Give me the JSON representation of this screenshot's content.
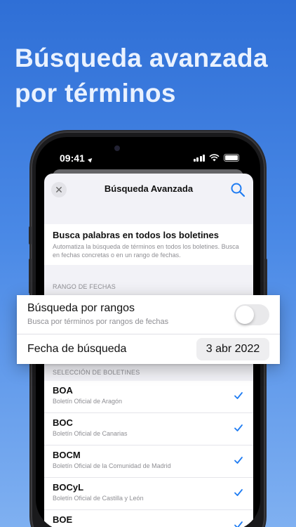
{
  "headline": [
    "Búsqueda avanzada",
    "por términos"
  ],
  "status_bar": {
    "time": "09:41"
  },
  "nav": {
    "title": "Búsqueda Avanzada"
  },
  "intro": {
    "title": "Busca palabras en todos los boletines",
    "description": "Automatiza la búsqueda de términos en todos los boletines. Busca en fechas concretas o en un rango de fechas."
  },
  "sections": {
    "date_range": "RANGO DE FECHAS",
    "bulletins": "SELECCIÓN DE BOLETINES"
  },
  "range_search": {
    "title": "Búsqueda por rangos",
    "subtitle": "Busca por términos por rangos de fechas",
    "enabled": false
  },
  "search_date": {
    "label": "Fecha de búsqueda",
    "value": "3 abr 2022"
  },
  "bulletins": [
    {
      "code": "BOA",
      "name": "Boletín Oficial de Aragón",
      "selected": true
    },
    {
      "code": "BOC",
      "name": "Boletín Oficial de Canarias",
      "selected": true
    },
    {
      "code": "BOCM",
      "name": "Boletín Oficial de la Comunidad de Madrid",
      "selected": true
    },
    {
      "code": "BOCyL",
      "name": "Boletín Oficial de Castilla y León",
      "selected": true
    },
    {
      "code": "BOE",
      "name": "",
      "selected": true
    }
  ],
  "colors": {
    "accent": "#1f7cf2",
    "background_top": "#2f6fd6",
    "background_bottom": "#7fb0f1"
  }
}
